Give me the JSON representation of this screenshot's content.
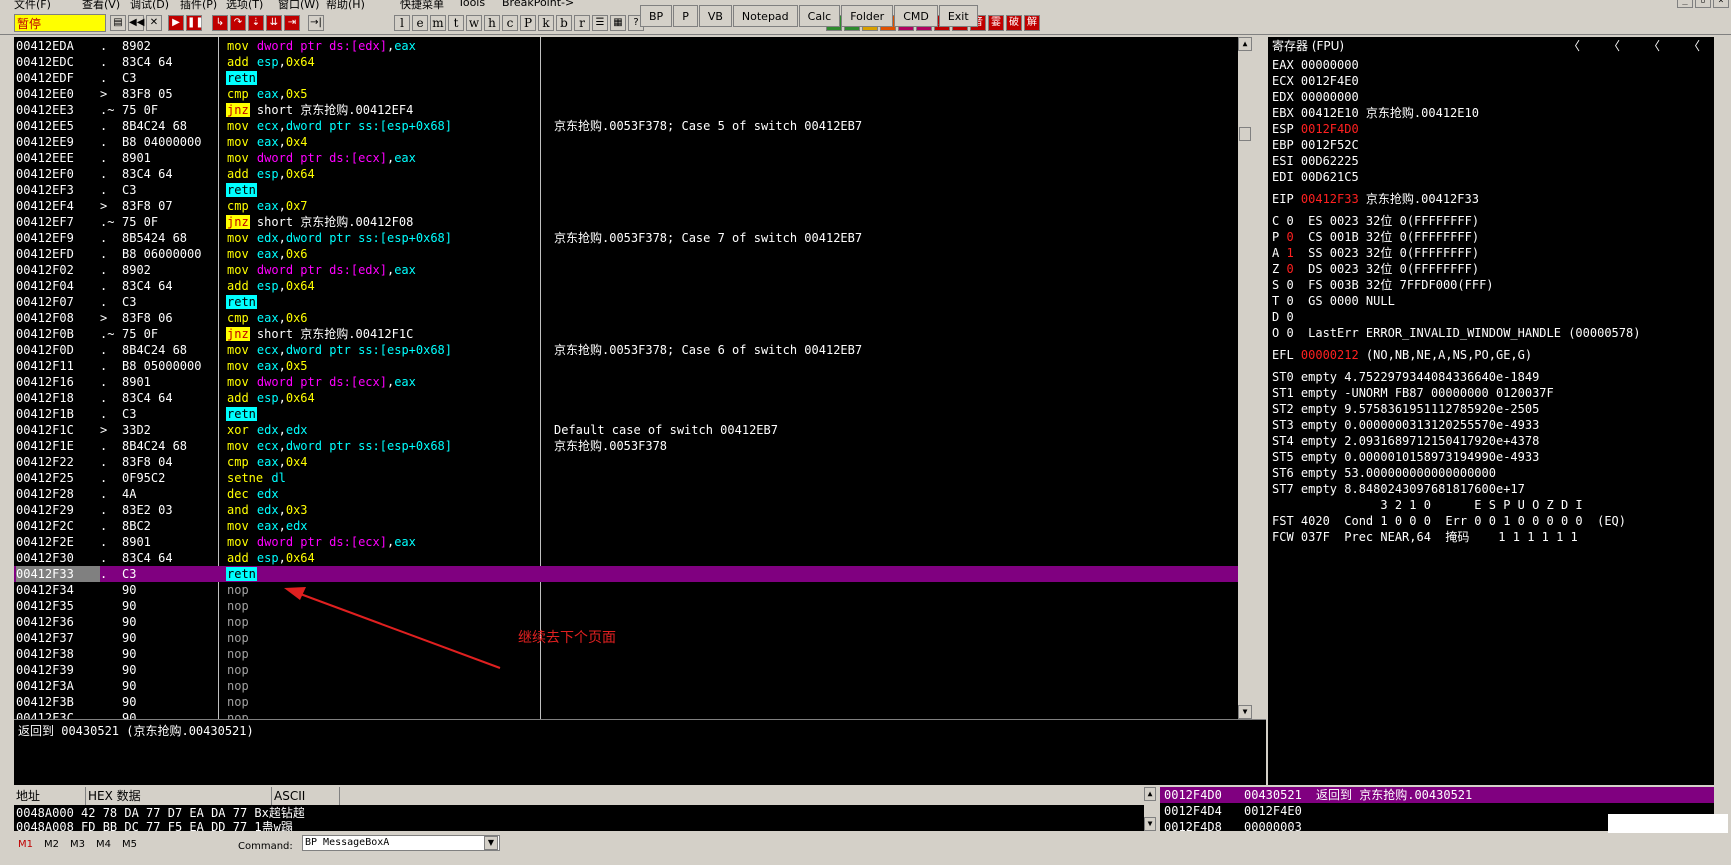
{
  "menu": {
    "items": [
      "文件(F)",
      "查看(V)",
      "调试(D)",
      "插件(P)",
      "选项(T)",
      "窗口(W)",
      "帮助(H)",
      "快捷菜单",
      "Tools",
      "BreakPoint->"
    ]
  },
  "toolbar": {
    "status": "暂停",
    "letters": [
      "l",
      "e",
      "m",
      "t",
      "w",
      "h",
      "c",
      "P",
      "k",
      "b",
      "r",
      "...",
      "s"
    ],
    "plugin_buttons": [
      "BP",
      "P",
      "VB",
      "Notepad",
      "Calc",
      "Folder",
      "CMD",
      "Exit"
    ],
    "plugin_icons": [
      "A",
      "E",
      "音",
      "霎",
      "破",
      "解"
    ]
  },
  "disasm": {
    "rows": [
      {
        "addr": "00412EDA",
        "arrow": ".",
        "hex": "8902",
        "mn": "mov",
        "ops": [
          [
            "dword ptr ds:[edx]",
            "mem"
          ],
          [
            ",",
            "op"
          ],
          [
            "eax",
            "mem2"
          ]
        ],
        "cmt": ""
      },
      {
        "addr": "00412EDC",
        "arrow": ".",
        "hex": "83C4 64",
        "mn": "add",
        "ops": [
          [
            "esp",
            "mem2"
          ],
          [
            ",",
            "op"
          ],
          [
            "0x64",
            "imm"
          ]
        ],
        "cmt": ""
      },
      {
        "addr": "00412EDF",
        "arrow": ".",
        "hex": "C3",
        "mn": "retn",
        "ops": [],
        "cmt": ""
      },
      {
        "addr": "00412EE0",
        "arrow": ">",
        "hex": "83F8 05",
        "mn": "cmp",
        "ops": [
          [
            "eax",
            "mem2"
          ],
          [
            ",",
            "op"
          ],
          [
            "0x5",
            "imm"
          ]
        ],
        "cmt": ""
      },
      {
        "addr": "00412EE3",
        "arrow": ".~",
        "hex": "75 0F",
        "mn": "jnz",
        "ops": [
          [
            "short 京东抢购.00412EF4",
            "op"
          ]
        ],
        "cmt": ""
      },
      {
        "addr": "00412EE5",
        "arrow": ".",
        "hex": "8B4C24 68",
        "mn": "mov",
        "ops": [
          [
            "ecx",
            "mem2"
          ],
          [
            ",",
            "op"
          ],
          [
            "dword ptr ss:[esp+0x68]",
            "mem2"
          ]
        ],
        "cmt": "京东抢购.0053F378; Case 5 of switch 00412EB7"
      },
      {
        "addr": "00412EE9",
        "arrow": ".",
        "hex": "B8 04000000",
        "mn": "mov",
        "ops": [
          [
            "eax",
            "mem2"
          ],
          [
            ",",
            "op"
          ],
          [
            "0x4",
            "imm"
          ]
        ],
        "cmt": ""
      },
      {
        "addr": "00412EEE",
        "arrow": ".",
        "hex": "8901",
        "mn": "mov",
        "ops": [
          [
            "dword ptr ds:[ecx]",
            "mem"
          ],
          [
            ",",
            "op"
          ],
          [
            "eax",
            "mem2"
          ]
        ],
        "cmt": ""
      },
      {
        "addr": "00412EF0",
        "arrow": ".",
        "hex": "83C4 64",
        "mn": "add",
        "ops": [
          [
            "esp",
            "mem2"
          ],
          [
            ",",
            "op"
          ],
          [
            "0x64",
            "imm"
          ]
        ],
        "cmt": ""
      },
      {
        "addr": "00412EF3",
        "arrow": ".",
        "hex": "C3",
        "mn": "retn",
        "ops": [],
        "cmt": ""
      },
      {
        "addr": "00412EF4",
        "arrow": ">",
        "hex": "83F8 07",
        "mn": "cmp",
        "ops": [
          [
            "eax",
            "mem2"
          ],
          [
            ",",
            "op"
          ],
          [
            "0x7",
            "imm"
          ]
        ],
        "cmt": ""
      },
      {
        "addr": "00412EF7",
        "arrow": ".~",
        "hex": "75 0F",
        "mn": "jnz",
        "ops": [
          [
            "short 京东抢购.00412F08",
            "op"
          ]
        ],
        "cmt": ""
      },
      {
        "addr": "00412EF9",
        "arrow": ".",
        "hex": "8B5424 68",
        "mn": "mov",
        "ops": [
          [
            "edx",
            "mem2"
          ],
          [
            ",",
            "op"
          ],
          [
            "dword ptr ss:[esp+0x68]",
            "mem2"
          ]
        ],
        "cmt": "京东抢购.0053F378; Case 7 of switch 00412EB7"
      },
      {
        "addr": "00412EFD",
        "arrow": ".",
        "hex": "B8 06000000",
        "mn": "mov",
        "ops": [
          [
            "eax",
            "mem2"
          ],
          [
            ",",
            "op"
          ],
          [
            "0x6",
            "imm"
          ]
        ],
        "cmt": ""
      },
      {
        "addr": "00412F02",
        "arrow": ".",
        "hex": "8902",
        "mn": "mov",
        "ops": [
          [
            "dword ptr ds:[edx]",
            "mem"
          ],
          [
            ",",
            "op"
          ],
          [
            "eax",
            "mem2"
          ]
        ],
        "cmt": ""
      },
      {
        "addr": "00412F04",
        "arrow": ".",
        "hex": "83C4 64",
        "mn": "add",
        "ops": [
          [
            "esp",
            "mem2"
          ],
          [
            ",",
            "op"
          ],
          [
            "0x64",
            "imm"
          ]
        ],
        "cmt": ""
      },
      {
        "addr": "00412F07",
        "arrow": ".",
        "hex": "C3",
        "mn": "retn",
        "ops": [],
        "cmt": ""
      },
      {
        "addr": "00412F08",
        "arrow": ">",
        "hex": "83F8 06",
        "mn": "cmp",
        "ops": [
          [
            "eax",
            "mem2"
          ],
          [
            ",",
            "op"
          ],
          [
            "0x6",
            "imm"
          ]
        ],
        "cmt": ""
      },
      {
        "addr": "00412F0B",
        "arrow": ".~",
        "hex": "75 0F",
        "mn": "jnz",
        "ops": [
          [
            "short 京东抢购.00412F1C",
            "op"
          ]
        ],
        "cmt": ""
      },
      {
        "addr": "00412F0D",
        "arrow": ".",
        "hex": "8B4C24 68",
        "mn": "mov",
        "ops": [
          [
            "ecx",
            "mem2"
          ],
          [
            ",",
            "op"
          ],
          [
            "dword ptr ss:[esp+0x68]",
            "mem2"
          ]
        ],
        "cmt": "京东抢购.0053F378; Case 6 of switch 00412EB7"
      },
      {
        "addr": "00412F11",
        "arrow": ".",
        "hex": "B8 05000000",
        "mn": "mov",
        "ops": [
          [
            "eax",
            "mem2"
          ],
          [
            ",",
            "op"
          ],
          [
            "0x5",
            "imm"
          ]
        ],
        "cmt": ""
      },
      {
        "addr": "00412F16",
        "arrow": ".",
        "hex": "8901",
        "mn": "mov",
        "ops": [
          [
            "dword ptr ds:[ecx]",
            "mem"
          ],
          [
            ",",
            "op"
          ],
          [
            "eax",
            "mem2"
          ]
        ],
        "cmt": ""
      },
      {
        "addr": "00412F18",
        "arrow": ".",
        "hex": "83C4 64",
        "mn": "add",
        "ops": [
          [
            "esp",
            "mem2"
          ],
          [
            ",",
            "op"
          ],
          [
            "0x64",
            "imm"
          ]
        ],
        "cmt": ""
      },
      {
        "addr": "00412F1B",
        "arrow": ".",
        "hex": "C3",
        "mn": "retn",
        "ops": [],
        "cmt": ""
      },
      {
        "addr": "00412F1C",
        "arrow": ">",
        "hex": "33D2",
        "mn": "xor",
        "ops": [
          [
            "edx",
            "mem2"
          ],
          [
            ",",
            "op"
          ],
          [
            "edx",
            "mem2"
          ]
        ],
        "cmt": "Default case of switch 00412EB7"
      },
      {
        "addr": "00412F1E",
        "arrow": ".",
        "hex": "8B4C24 68",
        "mn": "mov",
        "ops": [
          [
            "ecx",
            "mem2"
          ],
          [
            ",",
            "op"
          ],
          [
            "dword ptr ss:[esp+0x68]",
            "mem2"
          ]
        ],
        "cmt": "京东抢购.0053F378"
      },
      {
        "addr": "00412F22",
        "arrow": ".",
        "hex": "83F8 04",
        "mn": "cmp",
        "ops": [
          [
            "eax",
            "mem2"
          ],
          [
            ",",
            "op"
          ],
          [
            "0x4",
            "imm"
          ]
        ],
        "cmt": ""
      },
      {
        "addr": "00412F25",
        "arrow": ".",
        "hex": "0F95C2",
        "mn": "setne",
        "ops": [
          [
            "dl",
            "mem2"
          ]
        ],
        "cmt": ""
      },
      {
        "addr": "00412F28",
        "arrow": ".",
        "hex": "4A",
        "mn": "dec",
        "ops": [
          [
            "edx",
            "mem2"
          ]
        ],
        "cmt": ""
      },
      {
        "addr": "00412F29",
        "arrow": ".",
        "hex": "83E2 03",
        "mn": "and",
        "ops": [
          [
            "edx",
            "mem2"
          ],
          [
            ",",
            "op"
          ],
          [
            "0x3",
            "imm"
          ]
        ],
        "cmt": ""
      },
      {
        "addr": "00412F2C",
        "arrow": ".",
        "hex": "8BC2",
        "mn": "mov",
        "ops": [
          [
            "eax",
            "mem2"
          ],
          [
            ",",
            "op"
          ],
          [
            "edx",
            "mem2"
          ]
        ],
        "cmt": ""
      },
      {
        "addr": "00412F2E",
        "arrow": ".",
        "hex": "8901",
        "mn": "mov",
        "ops": [
          [
            "dword ptr ds:[ecx]",
            "mem"
          ],
          [
            ",",
            "op"
          ],
          [
            "eax",
            "mem2"
          ]
        ],
        "cmt": ""
      },
      {
        "addr": "00412F30",
        "arrow": ".",
        "hex": "83C4 64",
        "mn": "add",
        "ops": [
          [
            "esp",
            "mem2"
          ],
          [
            ",",
            "op"
          ],
          [
            "0x64",
            "imm"
          ]
        ],
        "cmt": ""
      },
      {
        "addr": "00412F33",
        "arrow": ".",
        "hex": "C3",
        "mn": "retn",
        "ops": [],
        "cmt": "",
        "selected": true
      },
      {
        "addr": "00412F34",
        "arrow": "",
        "hex": "90",
        "mn": "nop",
        "ops": [],
        "cmt": ""
      },
      {
        "addr": "00412F35",
        "arrow": "",
        "hex": "90",
        "mn": "nop",
        "ops": [],
        "cmt": ""
      },
      {
        "addr": "00412F36",
        "arrow": "",
        "hex": "90",
        "mn": "nop",
        "ops": [],
        "cmt": ""
      },
      {
        "addr": "00412F37",
        "arrow": "",
        "hex": "90",
        "mn": "nop",
        "ops": [],
        "cmt": ""
      },
      {
        "addr": "00412F38",
        "arrow": "",
        "hex": "90",
        "mn": "nop",
        "ops": [],
        "cmt": ""
      },
      {
        "addr": "00412F39",
        "arrow": "",
        "hex": "90",
        "mn": "nop",
        "ops": [],
        "cmt": ""
      },
      {
        "addr": "00412F3A",
        "arrow": "",
        "hex": "90",
        "mn": "nop",
        "ops": [],
        "cmt": ""
      },
      {
        "addr": "00412F3B",
        "arrow": "",
        "hex": "90",
        "mn": "nop",
        "ops": [],
        "cmt": ""
      },
      {
        "addr": "00412F3C",
        "arrow": "",
        "hex": "90",
        "mn": "nop",
        "ops": [],
        "cmt": ""
      }
    ]
  },
  "annotation": {
    "text": "继续去下个页面"
  },
  "info": {
    "text": "返回到 00430521 (京东抢购.00430521)"
  },
  "registers": {
    "title": "寄存器 (FPU)",
    "lines": [
      {
        "t": "EAX 00000000"
      },
      {
        "t": "ECX 0012F4E0"
      },
      {
        "t": "EDX 00000000"
      },
      {
        "t": "EBX 00412E10 京东抢购.00412E10"
      },
      {
        "t": "ESP ",
        "r": "0012F4D0"
      },
      {
        "t": "EBP 0012F52C"
      },
      {
        "t": "ESI 00D62225"
      },
      {
        "t": "EDI 00D621C5"
      },
      {
        "t": ""
      },
      {
        "t": "EIP ",
        "r": "00412F33",
        "t2": " 京东抢购.00412F33"
      },
      {
        "t": ""
      },
      {
        "t": "C 0  ES 0023 32位 0(FFFFFFFF)"
      },
      {
        "t": "P ",
        "r": "0",
        "t2": "  CS 001B 32位 0(FFFFFFFF)"
      },
      {
        "t": "A ",
        "r": "1",
        "t2": "  SS 0023 32位 0(FFFFFFFF)"
      },
      {
        "t": "Z ",
        "r": "0",
        "t2": "  DS 0023 32位 0(FFFFFFFF)"
      },
      {
        "t": "S 0  FS 003B 32位 7FFDF000(FFF)"
      },
      {
        "t": "T 0  GS 0000 NULL"
      },
      {
        "t": "D 0"
      },
      {
        "t": "O 0  LastErr ERROR_INVALID_WINDOW_HANDLE (00000578)"
      },
      {
        "t": ""
      },
      {
        "t": "EFL ",
        "r": "00000212",
        "t2": " (NO,NB,NE,A,NS,PO,GE,G)"
      },
      {
        "t": ""
      },
      {
        "t": "ST0 empty 4.7522979344084336640e-1849"
      },
      {
        "t": "ST1 empty -UNORM FB87 00000000 0120037F"
      },
      {
        "t": "ST2 empty 9.5758361951112785920e-2505"
      },
      {
        "t": "ST3 empty 0.0000000313120255570e-4933"
      },
      {
        "t": "ST4 empty 2.0931689712150417920e+4378"
      },
      {
        "t": "ST5 empty 0.0000010158973194990e-4933"
      },
      {
        "t": "ST6 empty 53.000000000000000000"
      },
      {
        "t": "ST7 empty 8.8480243097681817600e+17"
      },
      {
        "t": "               3 2 1 0      E S P U O Z D I"
      },
      {
        "t": "FST 4020  Cond 1 0 0 0  Err 0 0 1 0 0 0 0 0  (EQ)"
      },
      {
        "t": "FCW 037F  Prec NEAR,64  掩码    1 1 1 1 1 1"
      }
    ]
  },
  "dump": {
    "headers": [
      "地址",
      "HEX 数据",
      "ASCII"
    ],
    "rows": [
      {
        "t": "0048A000 42 78 DA 77 D7 EA DA 77 Bx趤钻趤"
      },
      {
        "t": "0048A008 FD BB DC 77 F5 EA DD 77 1蛊w蹋"
      }
    ]
  },
  "stack": {
    "rows": [
      {
        "a": "0012F4D0",
        "v": "00430521",
        "c": "返回到 京东抢购.00430521",
        "sel": true
      },
      {
        "a": "0012F4D4",
        "v": "0012F4E0",
        "c": ""
      },
      {
        "a": "0012F4D8",
        "v": "00000003",
        "c": ""
      }
    ]
  },
  "cmdbar": {
    "tabs": [
      "M1",
      "M2",
      "M3",
      "M4",
      "M5"
    ],
    "command_label": "Command:",
    "command_value": "BP  MessageBoxA"
  }
}
